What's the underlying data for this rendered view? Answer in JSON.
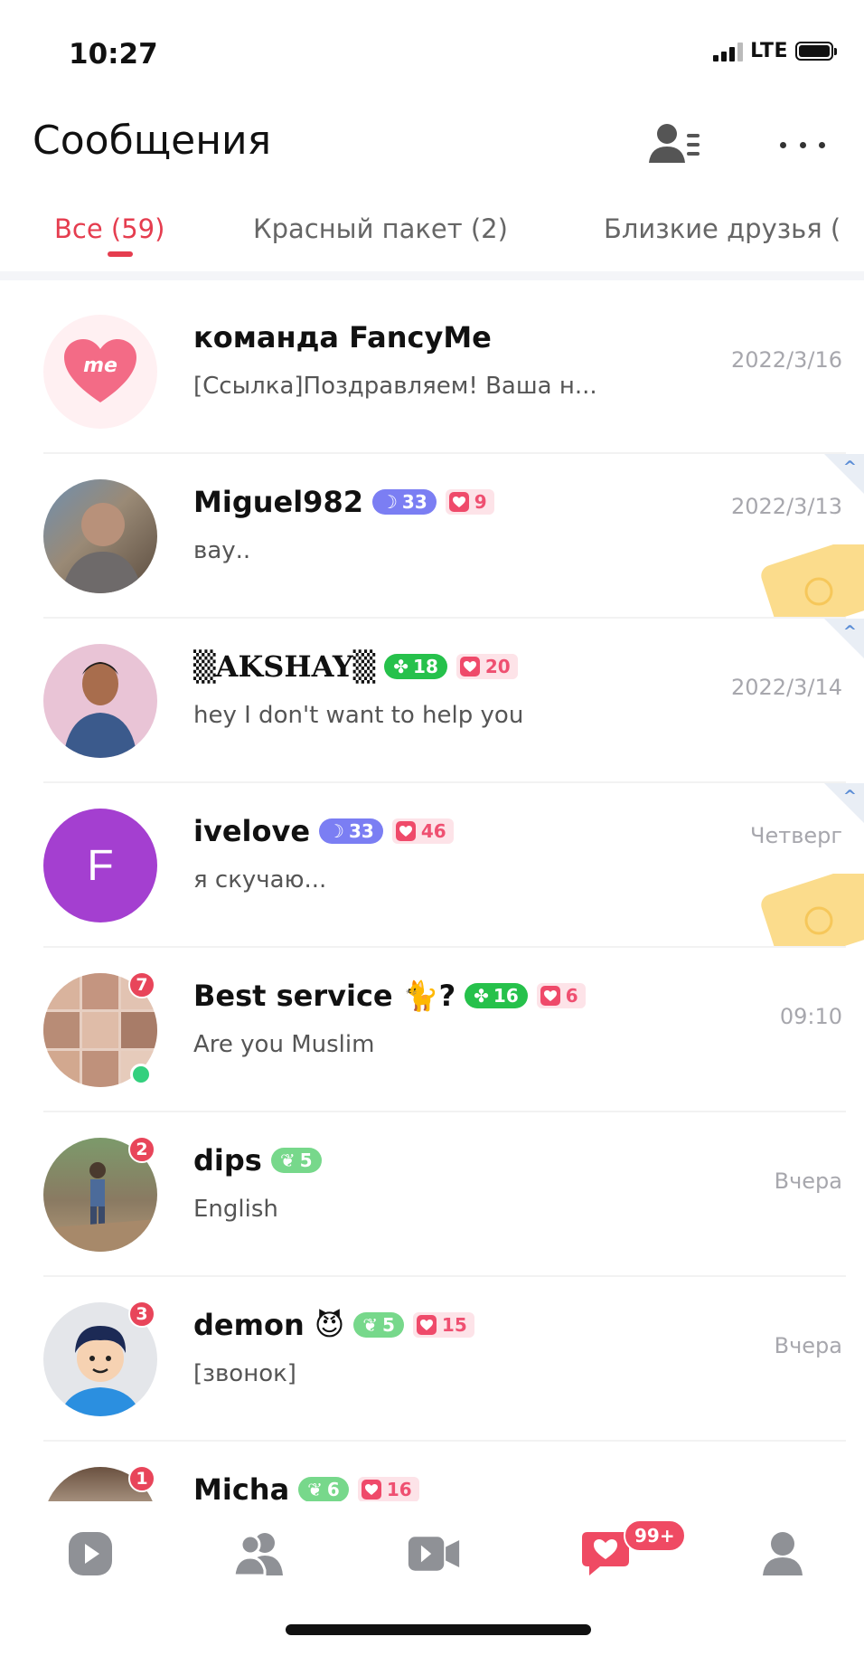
{
  "status": {
    "time": "10:27",
    "network": "LTE"
  },
  "header": {
    "title": "Сообщения"
  },
  "tabs": [
    {
      "label": "Все (59)",
      "active": true
    },
    {
      "label": "Красный пакет (2)",
      "active": false
    },
    {
      "label": "Близкие друзья (",
      "active": false
    }
  ],
  "messages": [
    {
      "name": "команда FancyMe",
      "preview": "[Ссылка]Поздравляем! Ваша н...",
      "date": "2022/3/16",
      "avatar": "fancyme-logo",
      "logo_text": "me"
    },
    {
      "name": "Miguel982",
      "preview": "вау..",
      "date": "2022/3/13",
      "level": "33",
      "level_color": "purple",
      "hearts": "9",
      "pinned": true,
      "envelope": true
    },
    {
      "name": "▒AKSHAY▒",
      "preview": "hey I don't want to help you",
      "date": "2022/3/14",
      "level": "18",
      "level_color": "green",
      "hearts": "20",
      "pinned": true
    },
    {
      "name": "ivelove",
      "preview": "я скучаю...",
      "date": "Четверг",
      "level": "33",
      "level_color": "purple",
      "hearts": "46",
      "pinned": true,
      "envelope": true,
      "avatar_letter": "F"
    },
    {
      "name": "Best service 🐈?",
      "preview": "Are you Muslim",
      "date": "09:10",
      "level": "16",
      "level_color": "green",
      "hearts": "6",
      "unread": "7",
      "online": true
    },
    {
      "name": "dips",
      "preview": "English",
      "date": "Вчера",
      "level": "5",
      "level_color": "lightgreen",
      "unread": "2"
    },
    {
      "name": "demon 😈",
      "preview": "[звонок]",
      "date": "Вчера",
      "level": "5",
      "level_color": "lightgreen",
      "hearts": "15",
      "unread": "3"
    },
    {
      "name": "Micha",
      "preview": "",
      "date": "",
      "level": "6",
      "level_color": "lightgreen",
      "hearts": "16",
      "unread": "1"
    }
  ],
  "bottom_nav": {
    "items": [
      "play-icon",
      "friends-icon",
      "video-icon",
      "messages-icon",
      "profile-icon"
    ],
    "messages_badge": "99+"
  },
  "colors": {
    "accent": "#e53d4f",
    "purple_level": "#7b7ef3",
    "green_level": "#26c14b"
  }
}
